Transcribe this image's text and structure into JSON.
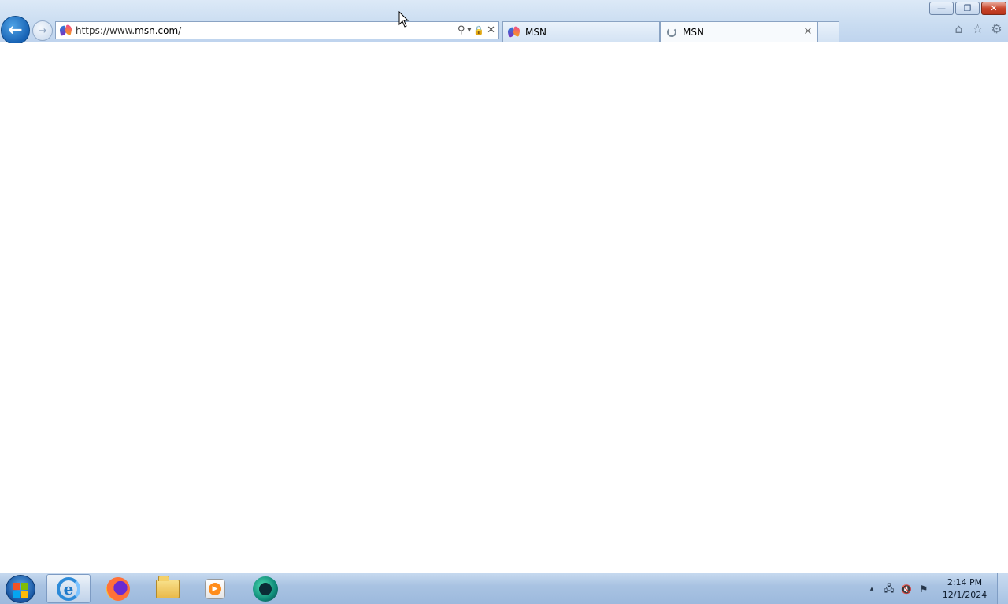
{
  "window": {
    "controls": {
      "minimize": "—",
      "restore": "❐",
      "close": "✕"
    }
  },
  "toolbar": {
    "back_icon": "←",
    "forward_icon": "→"
  },
  "address_bar": {
    "scheme": "https://www.",
    "domain": "msn.com",
    "path": "/",
    "search_icon": "⚲",
    "dropdown_icon": "▾",
    "lock_icon": "🔒",
    "stop_icon": "✕"
  },
  "tabs": [
    {
      "label": "MSN",
      "icon": "msn-butterfly-icon",
      "active": false
    },
    {
      "label": "MSN",
      "icon": "loading-spinner-icon",
      "active": true,
      "close": "✕"
    }
  ],
  "tools": {
    "home": "⌂",
    "favorites": "☆",
    "settings": "⚙"
  },
  "taskbar": {
    "apps": [
      {
        "name": "internet-explorer",
        "active": true
      },
      {
        "name": "firefox",
        "active": false
      },
      {
        "name": "file-explorer",
        "active": false
      },
      {
        "name": "media-player",
        "active": false
      },
      {
        "name": "app",
        "active": false
      }
    ],
    "tray": {
      "up_arrow": "▴",
      "network": "🖧",
      "volume": "🔇",
      "flag": "⚑"
    },
    "clock": {
      "time": "2:14 PM",
      "date": "12/1/2024"
    }
  }
}
